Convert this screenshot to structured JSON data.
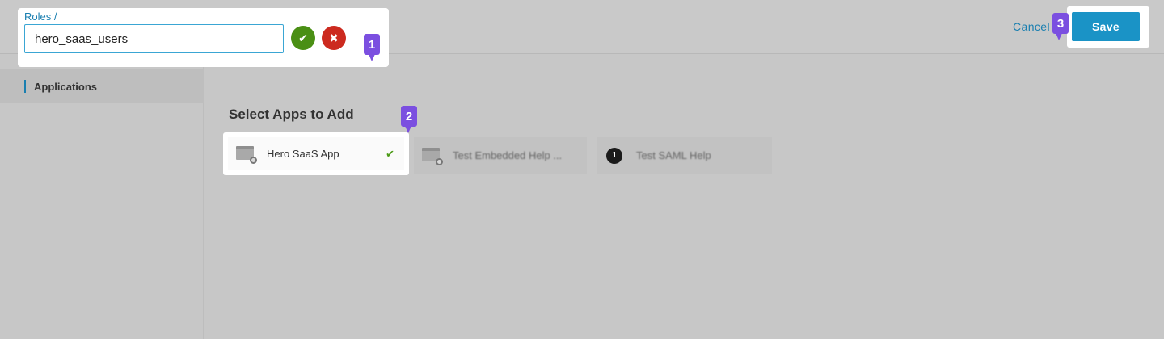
{
  "header": {
    "breadcrumb": "Roles /",
    "role_name_value": "hero_saas_users",
    "confirm_icon": "✔",
    "discard_icon": "✖",
    "cancel_label": "Cancel",
    "save_label": "Save"
  },
  "sidebar": {
    "items": [
      {
        "label": "Applications"
      }
    ]
  },
  "main": {
    "section_title": "Select Apps to Add",
    "apps": [
      {
        "name": "Hero SaaS App",
        "selected": true,
        "icon": "window-search-icon",
        "check": "✔"
      },
      {
        "name": "Test Embedded Help ...",
        "selected": false,
        "icon": "window-search-icon"
      },
      {
        "name": "Test SAML Help",
        "selected": false,
        "icon": "badge-icon",
        "badge": "1"
      }
    ]
  },
  "markers": [
    "1",
    "2",
    "3"
  ],
  "colors": {
    "accent": "#1a93c6",
    "confirm": "#4a8f14",
    "discard": "#cc2a1f",
    "marker": "#7b4fe0"
  }
}
